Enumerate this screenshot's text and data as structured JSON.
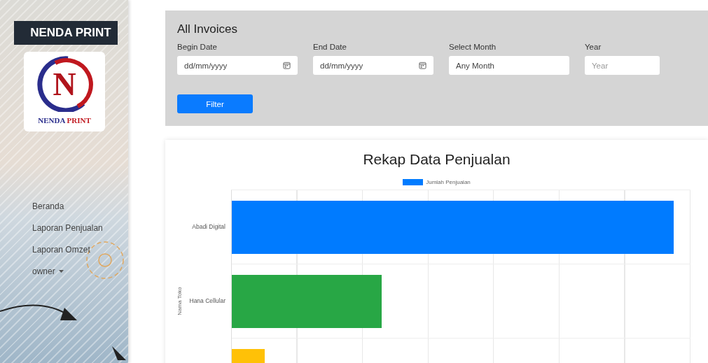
{
  "sidebar": {
    "brand": "NENDA PRINT",
    "logo": {
      "letter": "N",
      "caption_left": "NENDA",
      "caption_right": "PRINT"
    },
    "nav": [
      {
        "label": "Beranda",
        "kind": "link"
      },
      {
        "label": "Laporan Penjualan",
        "kind": "link"
      },
      {
        "label": "Laporan Omzet",
        "kind": "link"
      },
      {
        "label": "owner",
        "kind": "dropdown"
      }
    ]
  },
  "filter": {
    "title": "All Invoices",
    "fields": [
      {
        "label": "Begin Date",
        "kind": "date",
        "value": "dd/mm/yyyy"
      },
      {
        "label": "End Date",
        "kind": "date",
        "value": "dd/mm/yyyy"
      },
      {
        "label": "Select Month",
        "kind": "select",
        "value": "Any Month"
      },
      {
        "label": "Year",
        "kind": "text",
        "placeholder": "Year"
      }
    ],
    "button": "Filter"
  },
  "chart": {
    "title": "Rekap Data Penjualan",
    "legend": "Jumlah Penjualan",
    "ylabel": "Nama Toko",
    "categories": [
      {
        "label": "Abadi Digital",
        "color": "#007bff"
      },
      {
        "label": "Hana Cellular",
        "color": "#28a745"
      },
      {
        "color": "#ffc107"
      }
    ]
  }
}
